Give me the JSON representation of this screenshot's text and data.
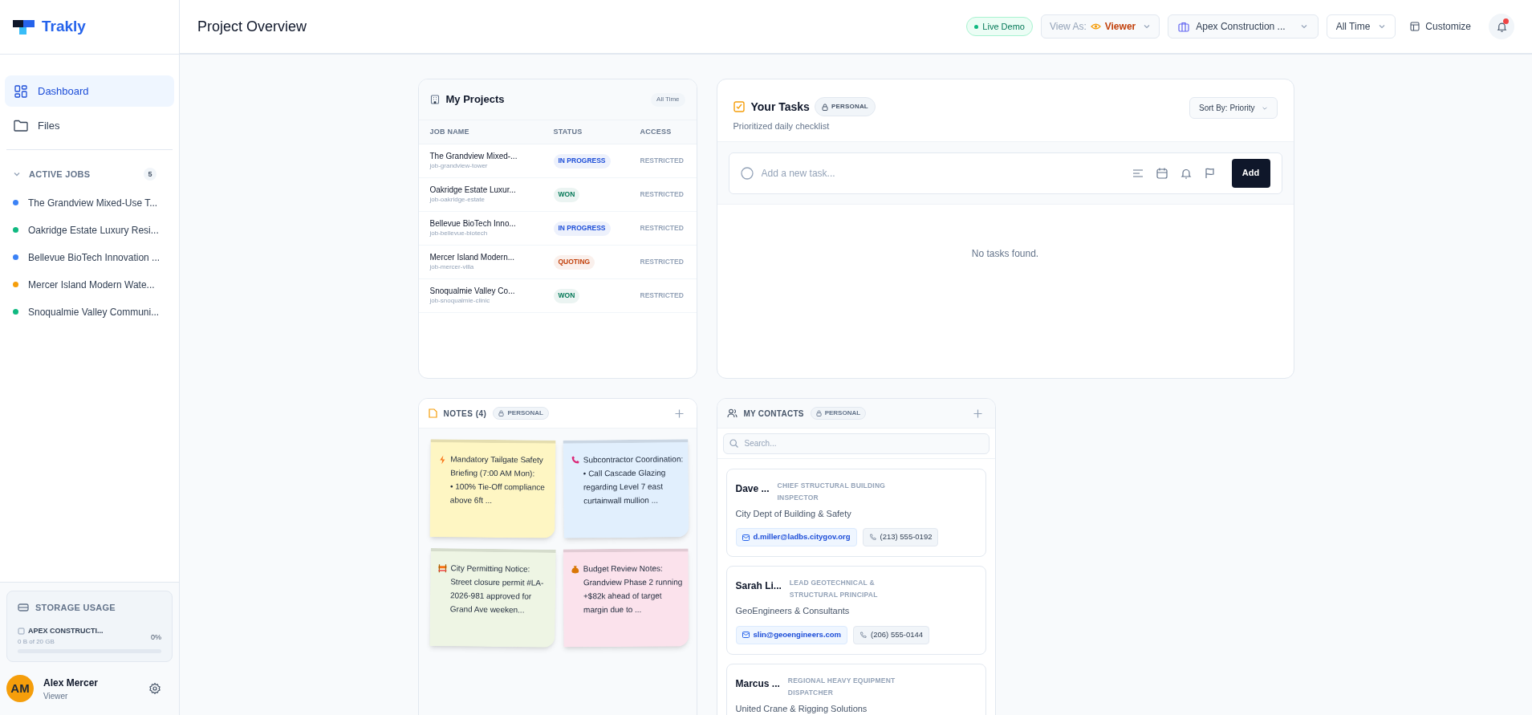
{
  "brand": {
    "name": "Trakly"
  },
  "nav": [
    {
      "label": "Dashboard",
      "kind": "dashboard",
      "selected": true
    },
    {
      "label": "Files",
      "kind": "files",
      "selected": false
    }
  ],
  "active_jobs": {
    "label": "ACTIVE JOBS",
    "count": "5",
    "expanded": true,
    "items": [
      {
        "name": "The Grandview Mixed-Use T...",
        "color": "#3b82f6"
      },
      {
        "name": "Oakridge Estate Luxury Resi...",
        "color": "#10b981"
      },
      {
        "name": "Bellevue BioTech Innovation ...",
        "color": "#3b82f6"
      },
      {
        "name": "Mercer Island Modern Wate...",
        "color": "#f59e0b"
      },
      {
        "name": "Snoqualmie Valley Communi...",
        "color": "#10b981"
      }
    ]
  },
  "storage": {
    "title": "STORAGE USAGE",
    "account": "APEX CONSTRUCTI...",
    "used": "0 B of 20 GB",
    "percent": "0%",
    "level": 0
  },
  "user": {
    "initials": "AM",
    "name": "Alex Mercer",
    "role": "Viewer"
  },
  "header": {
    "title": "Project Overview",
    "badge": "Live Demo",
    "view_as_label": "View As:",
    "view_as_value": "Viewer",
    "company": "Apex Construction ...",
    "range": "All Time",
    "customize": "Customize",
    "unread_notifications": true
  },
  "projects": {
    "title": "My Projects",
    "range": "All Time",
    "columns": [
      "JOB NAME",
      "STATUS",
      "ACCESS"
    ],
    "rows": [
      {
        "name": "The Grandview Mixed-...",
        "slug": "job-grandview-tower",
        "status": "IN PROGRESS",
        "color": "#1d4ed8",
        "access": "RESTRICTED"
      },
      {
        "name": "Oakridge Estate Luxur...",
        "slug": "job-oakridge-estate",
        "status": "WON",
        "color": "#047857",
        "access": "RESTRICTED"
      },
      {
        "name": "Bellevue BioTech Inno...",
        "slug": "job-bellevue-biotech",
        "status": "IN PROGRESS",
        "color": "#1d4ed8",
        "access": "RESTRICTED"
      },
      {
        "name": "Mercer Island Modern...",
        "slug": "job-mercer-villa",
        "status": "QUOTING",
        "color": "#c2410c",
        "access": "RESTRICTED"
      },
      {
        "name": "Snoqualmie Valley Co...",
        "slug": "job-snoqualmie-clinic",
        "status": "WON",
        "color": "#047857",
        "access": "RESTRICTED"
      }
    ]
  },
  "tasks": {
    "title": "Your Tasks",
    "badge": "PERSONAL",
    "subtitle": "Prioritized daily checklist",
    "sort": "Sort By: Priority",
    "placeholder": "Add a new task...",
    "add_button": "Add",
    "empty": "No tasks found."
  },
  "notes": {
    "title": "NOTES (4)",
    "badge": "PERSONAL",
    "items": [
      {
        "kind": "alert",
        "color": "#fef6c3",
        "text": "Mandatory Tailgate Safety Briefing (7:00 AM Mon):\n• 100% Tie-Off compliance above 6ft ..."
      },
      {
        "kind": "call",
        "color": "#e1effd",
        "text": "Subcontractor Coordination:\n• Call Cascade Glazing regarding Level 7 east curtainwall mullion ..."
      },
      {
        "kind": "permit",
        "color": "#eef5e4",
        "text": "City Permitting Notice:\nStreet closure permit #LA-2026-981 approved for Grand Ave weeken..."
      },
      {
        "kind": "budget",
        "color": "#fbe2ec",
        "text": "Budget Review Notes:\nGrandview Phase 2 running +$82k ahead of target margin due to ..."
      }
    ]
  },
  "contacts": {
    "title": "MY CONTACTS",
    "badge": "PERSONAL",
    "search_placeholder": "Search...",
    "items": [
      {
        "name": "Dave ...",
        "role": "CHIEF STRUCTURAL BUILDING INSPECTOR",
        "company": "City Dept of Building & Safety",
        "email": "d.miller@ladbs.citygov.org",
        "phone": "(213) 555-0192"
      },
      {
        "name": "Sarah Li...",
        "role": "LEAD GEOTECHNICAL & STRUCTURAL PRINCIPAL",
        "company": "GeoEngineers & Consultants",
        "email": "slin@geoengineers.com",
        "phone": "(206) 555-0144"
      },
      {
        "name": "Marcus ...",
        "role": "REGIONAL HEAVY EQUIPMENT DISPATCHER",
        "company": "United Crane & Rigging Solutions"
      }
    ]
  }
}
